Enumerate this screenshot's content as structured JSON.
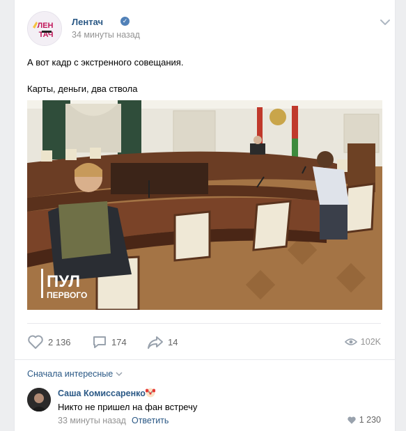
{
  "post": {
    "author": "Лентач",
    "time": "34 минуты назад",
    "text_line1": "А вот кадр с экстренного совещания.",
    "text_line2": "Карты, деньги, два ствола",
    "image_watermark_line1": "ПУЛ",
    "image_watermark_line2": "ПЕРВОГО",
    "avatar_logo": "ЛЕН ТАЧ"
  },
  "actions": {
    "likes": "2 136",
    "comments": "174",
    "shares": "14",
    "views": "102K",
    "like_icon": "heart-icon",
    "comment_icon": "comment-icon",
    "share_icon": "share-arrow-icon",
    "views_icon": "eye-icon"
  },
  "comments": {
    "sort_label": "Сначала интересные",
    "items": [
      {
        "author": "Саша Комиссаренко",
        "text": "Никто не пришел на фан встречу",
        "time": "33 минуты назад",
        "reply_label": "Ответить",
        "likes": "1 230"
      }
    ]
  },
  "colors": {
    "link": "#2a5885",
    "secondary": "#939393",
    "icon": "#99a2ad",
    "verified": "#5181b8",
    "background": "#edeef0"
  }
}
